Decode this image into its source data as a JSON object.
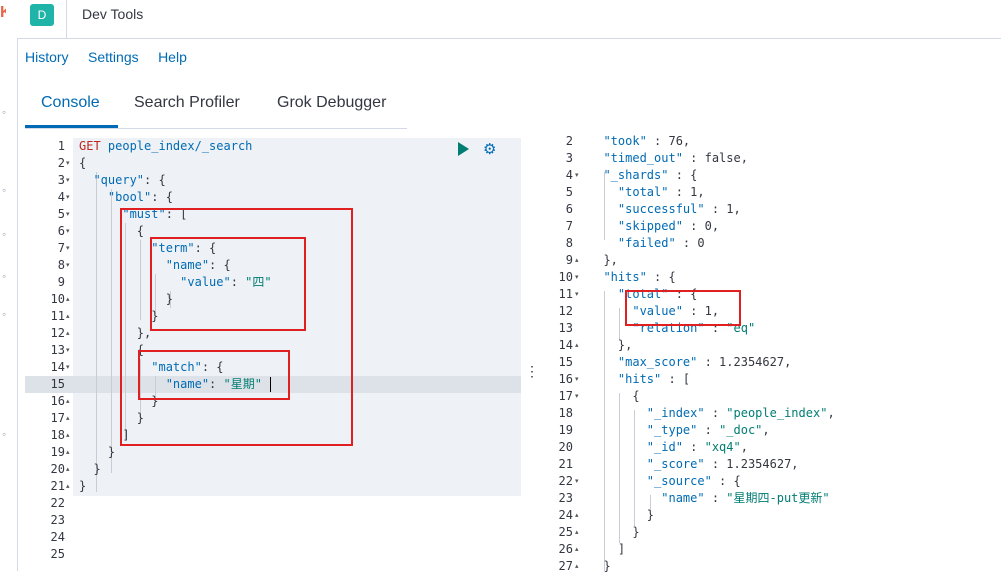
{
  "header": {
    "app_icon_letter": "D",
    "title": "Dev Tools"
  },
  "menu": {
    "history": "History",
    "settings": "Settings",
    "help": "Help"
  },
  "tabs": [
    "Console",
    "Search Profiler",
    "Grok Debugger"
  ],
  "active_tab": "Console",
  "editor": {
    "selected_line": 15,
    "lines": [
      {
        "n": "1",
        "fold": "",
        "segs": [
          [
            "GET ",
            "kw"
          ],
          [
            "people_index/_search",
            "str"
          ]
        ]
      },
      {
        "n": "2",
        "fold": "▾",
        "segs": [
          [
            "{",
            "pl"
          ]
        ]
      },
      {
        "n": "3",
        "fold": "▾",
        "segs": [
          [
            "  \"query\"",
            "str"
          ],
          [
            ": {",
            "pl"
          ]
        ]
      },
      {
        "n": "4",
        "fold": "▾",
        "segs": [
          [
            "    \"bool\"",
            "str"
          ],
          [
            ": {",
            "pl"
          ]
        ]
      },
      {
        "n": "5",
        "fold": "▾",
        "segs": [
          [
            "      \"must\"",
            "str"
          ],
          [
            ": [",
            "pl"
          ]
        ]
      },
      {
        "n": "6",
        "fold": "▾",
        "segs": [
          [
            "        {",
            "pl"
          ]
        ]
      },
      {
        "n": "7",
        "fold": "▾",
        "segs": [
          [
            "          \"term\"",
            "str"
          ],
          [
            ": {",
            "pl"
          ]
        ]
      },
      {
        "n": "8",
        "fold": "▾",
        "segs": [
          [
            "            \"name\"",
            "str"
          ],
          [
            ": {",
            "pl"
          ]
        ]
      },
      {
        "n": "9",
        "fold": "",
        "segs": [
          [
            "              \"value\"",
            "str"
          ],
          [
            ": ",
            "pl"
          ],
          [
            "\"四\"",
            "val"
          ]
        ]
      },
      {
        "n": "10",
        "fold": "▴",
        "segs": [
          [
            "            }",
            "pl"
          ]
        ]
      },
      {
        "n": "11",
        "fold": "▴",
        "segs": [
          [
            "          }",
            "pl"
          ]
        ]
      },
      {
        "n": "12",
        "fold": "▴",
        "segs": [
          [
            "        },",
            "pl"
          ]
        ]
      },
      {
        "n": "13",
        "fold": "▾",
        "segs": [
          [
            "        {",
            "pl"
          ]
        ]
      },
      {
        "n": "14",
        "fold": "▾",
        "segs": [
          [
            "          \"match\"",
            "str"
          ],
          [
            ": {",
            "pl"
          ]
        ]
      },
      {
        "n": "15",
        "fold": "",
        "segs": [
          [
            "            \"name\"",
            "str"
          ],
          [
            ": ",
            "pl"
          ],
          [
            "\"星期\"",
            "val"
          ]
        ]
      },
      {
        "n": "16",
        "fold": "▴",
        "segs": [
          [
            "          }",
            "pl"
          ]
        ]
      },
      {
        "n": "17",
        "fold": "▴",
        "segs": [
          [
            "        }",
            "pl"
          ]
        ]
      },
      {
        "n": "18",
        "fold": "▴",
        "segs": [
          [
            "      ]",
            "pl"
          ]
        ]
      },
      {
        "n": "19",
        "fold": "▴",
        "segs": [
          [
            "    }",
            "pl"
          ]
        ]
      },
      {
        "n": "20",
        "fold": "▴",
        "segs": [
          [
            "  }",
            "pl"
          ]
        ]
      },
      {
        "n": "21",
        "fold": "▴",
        "segs": [
          [
            "}",
            "pl"
          ]
        ]
      },
      {
        "n": "22",
        "fold": "",
        "segs": []
      },
      {
        "n": "23",
        "fold": "",
        "segs": []
      },
      {
        "n": "24",
        "fold": "",
        "segs": []
      },
      {
        "n": "25",
        "fold": "",
        "segs": []
      }
    ]
  },
  "output": {
    "lines": [
      {
        "n": "2",
        "fold": "",
        "segs": [
          [
            "  \"took\"",
            "key"
          ],
          [
            " : 76,",
            "pl"
          ]
        ]
      },
      {
        "n": "3",
        "fold": "",
        "segs": [
          [
            "  \"timed_out\"",
            "key"
          ],
          [
            " : false,",
            "pl"
          ]
        ]
      },
      {
        "n": "4",
        "fold": "▾",
        "segs": [
          [
            "  \"_shards\"",
            "key"
          ],
          [
            " : {",
            "pl"
          ]
        ]
      },
      {
        "n": "5",
        "fold": "",
        "segs": [
          [
            "    \"total\"",
            "key"
          ],
          [
            " : 1,",
            "pl"
          ]
        ]
      },
      {
        "n": "6",
        "fold": "",
        "segs": [
          [
            "    \"successful\"",
            "key"
          ],
          [
            " : 1,",
            "pl"
          ]
        ]
      },
      {
        "n": "7",
        "fold": "",
        "segs": [
          [
            "    \"skipped\"",
            "key"
          ],
          [
            " : 0,",
            "pl"
          ]
        ]
      },
      {
        "n": "8",
        "fold": "",
        "segs": [
          [
            "    \"failed\"",
            "key"
          ],
          [
            " : 0",
            "pl"
          ]
        ]
      },
      {
        "n": "9",
        "fold": "▴",
        "segs": [
          [
            "  },",
            "pl"
          ]
        ]
      },
      {
        "n": "10",
        "fold": "▾",
        "segs": [
          [
            "  \"hits\"",
            "key"
          ],
          [
            " : {",
            "pl"
          ]
        ]
      },
      {
        "n": "11",
        "fold": "▾",
        "segs": [
          [
            "    \"total\"",
            "key"
          ],
          [
            " : {",
            "pl"
          ]
        ]
      },
      {
        "n": "12",
        "fold": "",
        "segs": [
          [
            "      \"value\"",
            "key"
          ],
          [
            " : 1,",
            "pl"
          ]
        ]
      },
      {
        "n": "13",
        "fold": "",
        "segs": [
          [
            "      \"relation\"",
            "key"
          ],
          [
            " : ",
            "pl"
          ],
          [
            "\"eq\"",
            "str"
          ]
        ]
      },
      {
        "n": "14",
        "fold": "▴",
        "segs": [
          [
            "    },",
            "pl"
          ]
        ]
      },
      {
        "n": "15",
        "fold": "",
        "segs": [
          [
            "    \"max_score\"",
            "key"
          ],
          [
            " : 1.2354627,",
            "pl"
          ]
        ]
      },
      {
        "n": "16",
        "fold": "▾",
        "segs": [
          [
            "    \"hits\"",
            "key"
          ],
          [
            " : [",
            "pl"
          ]
        ]
      },
      {
        "n": "17",
        "fold": "▾",
        "segs": [
          [
            "      {",
            "pl"
          ]
        ]
      },
      {
        "n": "18",
        "fold": "",
        "segs": [
          [
            "        \"_index\"",
            "key"
          ],
          [
            " : ",
            "pl"
          ],
          [
            "\"people_index\"",
            "str"
          ],
          [
            ",",
            "pl"
          ]
        ]
      },
      {
        "n": "19",
        "fold": "",
        "segs": [
          [
            "        \"_type\"",
            "key"
          ],
          [
            " : ",
            "pl"
          ],
          [
            "\"_doc\"",
            "str"
          ],
          [
            ",",
            "pl"
          ]
        ]
      },
      {
        "n": "20",
        "fold": "",
        "segs": [
          [
            "        \"_id\"",
            "key"
          ],
          [
            " : ",
            "pl"
          ],
          [
            "\"xq4\"",
            "str"
          ],
          [
            ",",
            "pl"
          ]
        ]
      },
      {
        "n": "21",
        "fold": "",
        "segs": [
          [
            "        \"_score\"",
            "key"
          ],
          [
            " : 1.2354627,",
            "pl"
          ]
        ]
      },
      {
        "n": "22",
        "fold": "▾",
        "segs": [
          [
            "        \"_source\"",
            "key"
          ],
          [
            " : {",
            "pl"
          ]
        ]
      },
      {
        "n": "23",
        "fold": "",
        "segs": [
          [
            "          \"name\"",
            "key"
          ],
          [
            " : ",
            "pl"
          ],
          [
            "\"星期四-put更新\"",
            "str"
          ]
        ]
      },
      {
        "n": "24",
        "fold": "▴",
        "segs": [
          [
            "        }",
            "pl"
          ]
        ]
      },
      {
        "n": "25",
        "fold": "▴",
        "segs": [
          [
            "      }",
            "pl"
          ]
        ]
      },
      {
        "n": "26",
        "fold": "▴",
        "segs": [
          [
            "    ]",
            "pl"
          ]
        ]
      },
      {
        "n": "27",
        "fold": "▴",
        "segs": [
          [
            "  }",
            "pl"
          ]
        ]
      }
    ]
  },
  "colors": {
    "accent": "#006bb4",
    "app_icon": "#20b4a8",
    "annotation_box": "#e02020",
    "editor_bg": "#eef1f6"
  }
}
